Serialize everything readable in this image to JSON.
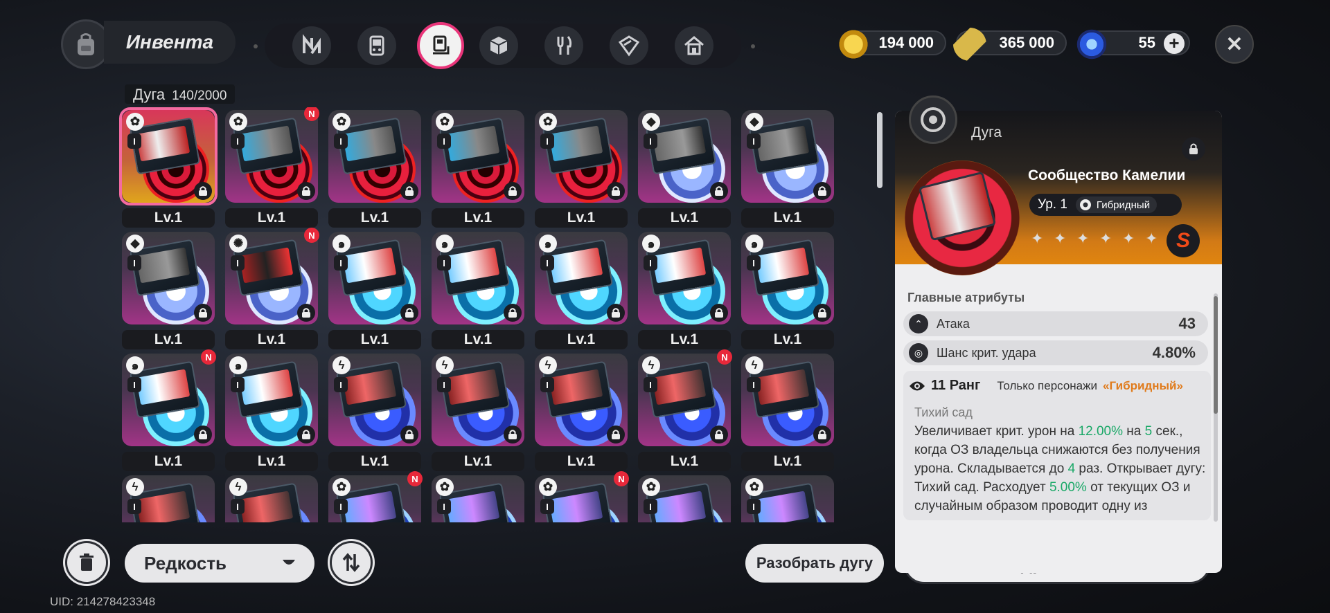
{
  "header": {
    "title": "Инвента"
  },
  "tabs": [
    {
      "icon": "n-logo-icon"
    },
    {
      "icon": "device-icon"
    },
    {
      "icon": "disc-drive-icon",
      "active": true
    },
    {
      "icon": "cube-icon"
    },
    {
      "icon": "fork-knife-icon"
    },
    {
      "icon": "box-icon"
    },
    {
      "icon": "house-icon"
    }
  ],
  "currencies": {
    "coins": "194 000",
    "tickets": "365 000",
    "crystals": "55"
  },
  "grid": {
    "category": "Дуга",
    "count": "140/2000",
    "items": [
      {
        "level": "Lv.1",
        "type": "gear",
        "theme": "red",
        "cart": "red",
        "gold": true,
        "selected": true,
        "new": false
      },
      {
        "level": "Lv.1",
        "type": "gear",
        "theme": "red",
        "cart": "rain",
        "new": true
      },
      {
        "level": "Lv.1",
        "type": "gear",
        "theme": "red",
        "cart": "rain",
        "new": false
      },
      {
        "level": "Lv.1",
        "type": "gear",
        "theme": "red",
        "cart": "rain",
        "new": false
      },
      {
        "level": "Lv.1",
        "type": "gear",
        "theme": "red",
        "cart": "rain",
        "new": false
      },
      {
        "level": "Lv.1",
        "type": "cube",
        "theme": "white",
        "cart": "grey",
        "new": false
      },
      {
        "level": "Lv.1",
        "type": "cube",
        "theme": "white",
        "cart": "grey",
        "new": false
      },
      {
        "level": "Lv.1",
        "type": "cube",
        "theme": "white",
        "cart": "grey",
        "new": false
      },
      {
        "level": "Lv.1",
        "type": "spin",
        "theme": "white",
        "cart": "raven",
        "new": true
      },
      {
        "level": "Lv.1",
        "type": "swirl",
        "theme": "cyan",
        "cart": "crane",
        "new": false
      },
      {
        "level": "Lv.1",
        "type": "swirl",
        "theme": "cyan",
        "cart": "crane",
        "new": false
      },
      {
        "level": "Lv.1",
        "type": "swirl",
        "theme": "cyan",
        "cart": "crane",
        "new": false
      },
      {
        "level": "Lv.1",
        "type": "swirl",
        "theme": "cyan",
        "cart": "crane",
        "new": false
      },
      {
        "level": "Lv.1",
        "type": "swirl",
        "theme": "cyan",
        "cart": "crane",
        "new": false
      },
      {
        "level": "Lv.1",
        "type": "swirl",
        "theme": "cyan",
        "cart": "crane",
        "new": true
      },
      {
        "level": "Lv.1",
        "type": "swirl",
        "theme": "cyan",
        "cart": "crane",
        "new": false
      },
      {
        "level": "Lv.1",
        "type": "bolt",
        "theme": "storm",
        "cart": "bolt",
        "new": false
      },
      {
        "level": "Lv.1",
        "type": "bolt",
        "theme": "storm",
        "cart": "bolt",
        "new": false
      },
      {
        "level": "Lv.1",
        "type": "bolt",
        "theme": "storm",
        "cart": "bolt",
        "new": false
      },
      {
        "level": "Lv.1",
        "type": "bolt",
        "theme": "storm",
        "cart": "bolt",
        "new": true
      },
      {
        "level": "Lv.1",
        "type": "bolt",
        "theme": "storm",
        "cart": "bolt",
        "new": false
      },
      {
        "level": "",
        "type": "bolt",
        "theme": "storm",
        "cart": "bolt",
        "new": false
      },
      {
        "level": "",
        "type": "bolt",
        "theme": "storm",
        "cart": "bolt",
        "new": false
      },
      {
        "level": "",
        "type": "gear",
        "theme": "blue",
        "cart": "purple",
        "new": true
      },
      {
        "level": "",
        "type": "gear",
        "theme": "blue",
        "cart": "purple",
        "new": false
      },
      {
        "level": "",
        "type": "gear",
        "theme": "blue",
        "cart": "purple",
        "new": true
      },
      {
        "level": "",
        "type": "gear",
        "theme": "blue",
        "cart": "purple",
        "new": false
      },
      {
        "level": "",
        "type": "gear",
        "theme": "blue",
        "cart": "purple",
        "new": false
      }
    ],
    "rank_label": "I",
    "new_label": "N"
  },
  "controls": {
    "sort_label": "Редкость",
    "dismantle_label": "Разобрать дугу",
    "details_label": "Подробности"
  },
  "uid": "UID: 214278423348",
  "detail": {
    "header": "Дуга",
    "name": "Сообщество Камелии",
    "level": "Ур. 1",
    "type": "Гибридный",
    "rarity": "S",
    "main_attributes_title": "Главные атрибуты",
    "attributes": [
      {
        "label": "Атака",
        "value": "43",
        "icon": "attack-icon"
      },
      {
        "label": "Шанс крит. удара",
        "value": "4.80%",
        "icon": "crit-icon"
      }
    ],
    "rank": "11 Ранг",
    "only_label": "Только персонажи",
    "only_type": "«Гибридный»",
    "skill_name": "Тихий сад",
    "skill_text": {
      "p1": "Увеличивает крит. урон на ",
      "v1": "12.00%",
      "p2": " на ",
      "v2": "5",
      "p3": " сек., когда ОЗ владельца снижаются без получения урона. Складывается до ",
      "v3": "4",
      "p4": " раз. Открывает дугу: Тихий сад. Расходует ",
      "v4": "5.00%",
      "p5": " от текущих ОЗ и случайным образом проводит одну из"
    }
  },
  "colors": {
    "accent_pink": "#e9357a",
    "highlight_green": "#1aa867",
    "type_orange": "#e07a1a",
    "new_red": "#e8283a"
  }
}
